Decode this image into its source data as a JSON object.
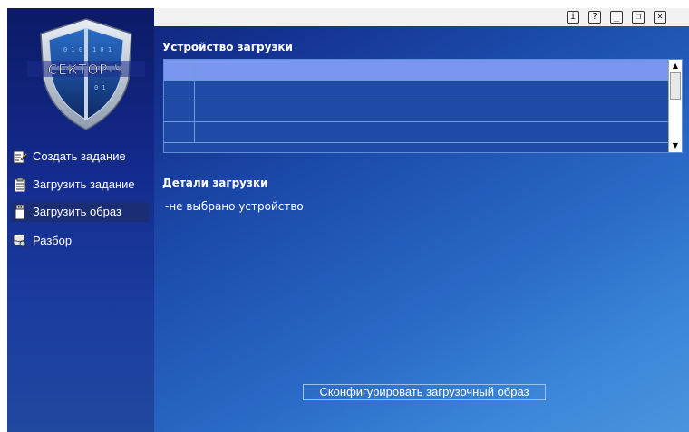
{
  "brand": {
    "logo_text": "СЕКТОР-Ч"
  },
  "titlebar": {
    "buttons": [
      {
        "name": "info-button",
        "glyph": "i"
      },
      {
        "name": "help-button",
        "glyph": "?"
      },
      {
        "name": "minimize-button",
        "glyph": "_"
      },
      {
        "name": "restore-button",
        "glyph": "❐"
      },
      {
        "name": "close-button",
        "glyph": "✕"
      }
    ]
  },
  "sidebar": {
    "items": [
      {
        "label": "Создать задание",
        "icon": "edit-icon"
      },
      {
        "label": "Загрузить задание",
        "icon": "clipboard-icon"
      },
      {
        "label": "Загрузить образ",
        "icon": "usb-drive-icon",
        "active": true
      },
      {
        "label": "Разбор",
        "icon": "database-search-icon"
      }
    ]
  },
  "device_section": {
    "title": "Устройство загрузки",
    "rows": [
      {
        "col1": "",
        "col2": "",
        "selected": true
      },
      {
        "col1": "",
        "col2": ""
      },
      {
        "col1": "",
        "col2": ""
      },
      {
        "col1": "",
        "col2": ""
      }
    ],
    "scroll_up": "▲",
    "scroll_down": "▼"
  },
  "details_section": {
    "title": "Детали загрузки",
    "text": "-не выбрано устройство"
  },
  "config_button": {
    "label": "Сконфигурировать загрузочный образ"
  },
  "colors": {
    "selected_row": "#7b96ef",
    "sidebar_active": "#1b2e73",
    "background_dark": "#0d1d6e",
    "background_light": "#4a93dd"
  }
}
